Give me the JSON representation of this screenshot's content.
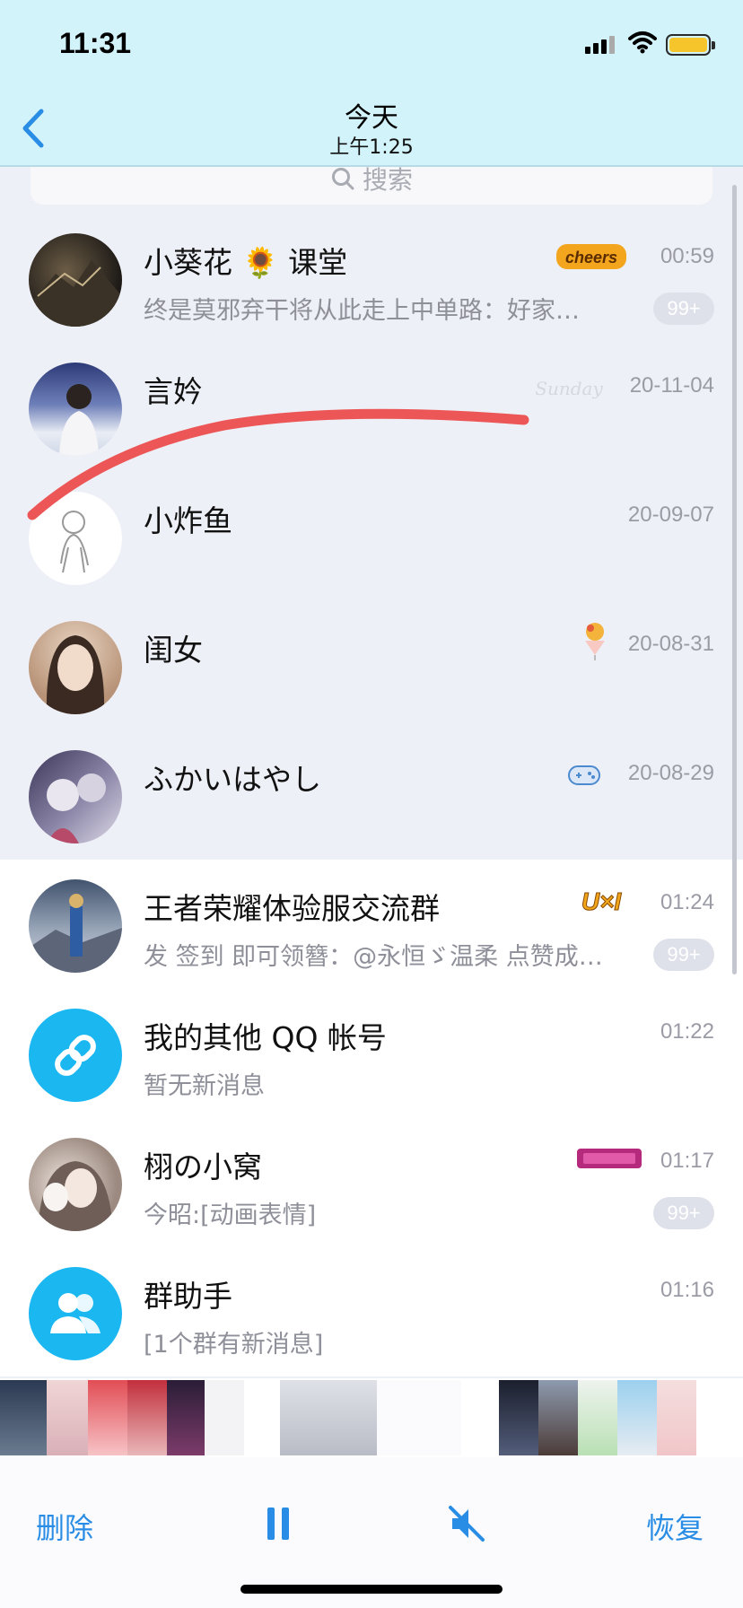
{
  "status": {
    "time": "11:31"
  },
  "nav": {
    "title": "今天",
    "subtitle": "上午1:25"
  },
  "search": {
    "placeholder": "搜索"
  },
  "conversations": [
    {
      "name": "小葵花",
      "name_suffix": "课堂",
      "preview": "终是莫邪弃干将从此走上中单路：好家…",
      "time": "00:59",
      "badge": "99+",
      "tag": "cheers"
    },
    {
      "name": "言妗",
      "preview": "",
      "time": "20-11-04",
      "tag": "sunday"
    },
    {
      "name": "小炸鱼",
      "preview": "",
      "time": "20-09-07"
    },
    {
      "name": "闺女",
      "preview": "",
      "time": "20-08-31",
      "tag": "ice-cream"
    },
    {
      "name": "ふかいはやし",
      "preview": "",
      "time": "20-08-29",
      "tag": "gamepad"
    },
    {
      "name": "王者荣耀体验服交流群",
      "preview": "发 签到 即可领簪：@永恒ゞ温柔 点赞成…",
      "time": "01:24",
      "badge": "99+",
      "tag": "U×I"
    },
    {
      "name": "我的其他 QQ 帐号",
      "preview": "暂无新消息",
      "time": "01:22"
    },
    {
      "name": "栩の小窝",
      "preview": "今昭:[动画表情]",
      "time": "01:17",
      "badge": "99+",
      "tag": "pink-badge"
    },
    {
      "name": "群助手",
      "preview": "[1个群有新消息]",
      "time": "01:16"
    }
  ],
  "controls": {
    "delete": "删除",
    "restore": "恢复"
  },
  "colors": {
    "accent": "#2a8de5",
    "header": "#d3f3fb",
    "badge": "#dfe1ea",
    "red_annotation": "#ec5656"
  }
}
